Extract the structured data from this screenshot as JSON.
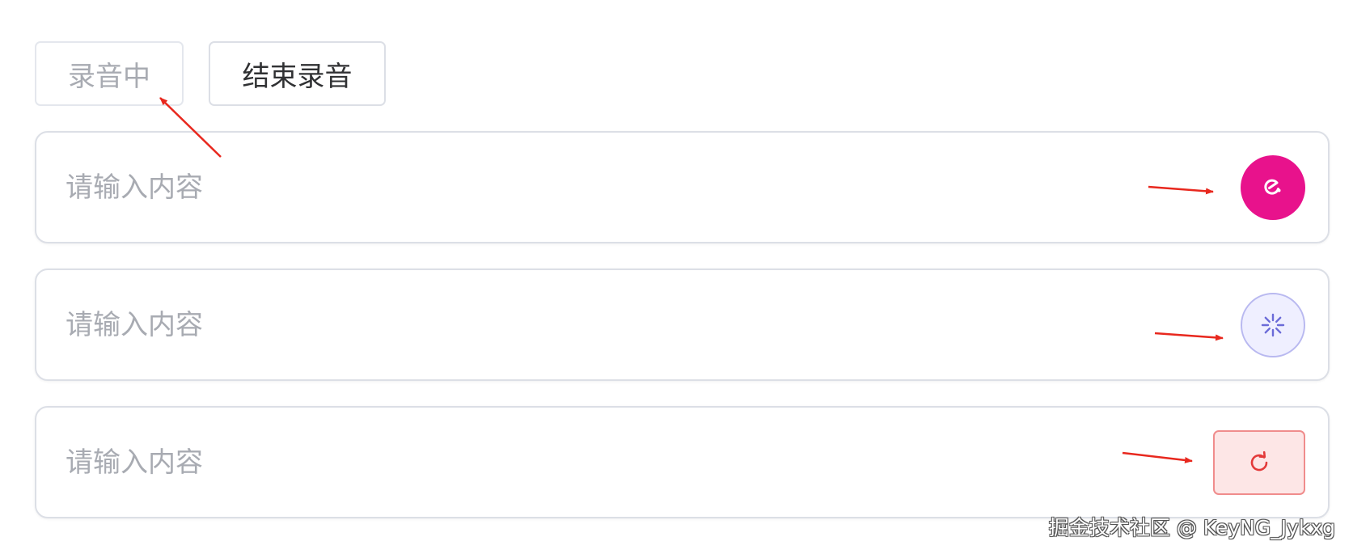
{
  "toolbar": {
    "recording_label": "录音中",
    "stop_label": "结束录音"
  },
  "inputs": [
    {
      "placeholder": "请输入内容",
      "action_state": "recording",
      "action_icon": "microphone-icon"
    },
    {
      "placeholder": "请输入内容",
      "action_state": "loading",
      "action_icon": "loading-spinner-icon"
    },
    {
      "placeholder": "请输入内容",
      "action_state": "error",
      "action_icon": "refresh-icon"
    }
  ],
  "colors": {
    "mic_bg": "#e8128c",
    "loading_bg": "#efefff",
    "loading_border": "#b9b9f0",
    "loading_icon": "#6b6bd8",
    "retry_bg": "#fde6e6",
    "retry_border": "#f08c8c",
    "retry_icon": "#e33a3a",
    "annotation_arrow": "#e8281e"
  },
  "watermark": "掘金技术社区 @ KeyNG_Jykxg"
}
